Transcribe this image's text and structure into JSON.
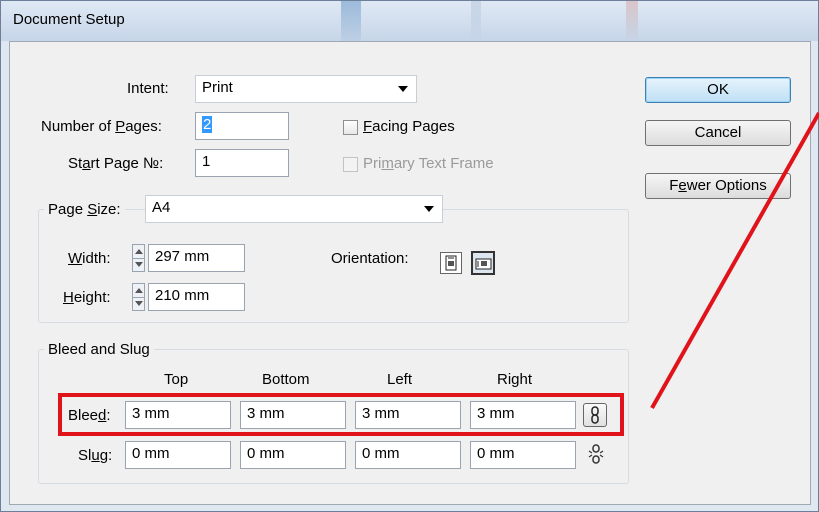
{
  "window": {
    "title": "Document Setup"
  },
  "intent": {
    "label": "Intent:",
    "value": "Print"
  },
  "pages": {
    "label_pre": "Number of ",
    "label_key": "P",
    "label_post": "ages:",
    "value": "2"
  },
  "start_page": {
    "label_pre": "St",
    "label_key": "a",
    "label_post": "rt Page №:",
    "value": "1"
  },
  "facing_pages": {
    "label_key": "F",
    "label_post": "acing Pages",
    "checked": false
  },
  "primary_text_frame": {
    "label_pre": "Pri",
    "label_key": "m",
    "label_post": "ary Text Frame",
    "checked": false,
    "enabled": false
  },
  "buttons": {
    "ok": "OK",
    "cancel": "Cancel",
    "fewer_pre": "F",
    "fewer_key": "e",
    "fewer_post": "wer Options"
  },
  "page_size": {
    "legend_pre": "Page ",
    "legend_key": "S",
    "legend_post": "ize:",
    "value": "A4",
    "width_label_key": "W",
    "width_label_post": "idth:",
    "width_value": "297 mm",
    "height_label_key": "H",
    "height_label_post": "eight:",
    "height_value": "210 mm",
    "orientation_label": "Orientation:"
  },
  "bleed_slug": {
    "legend": "Bleed and Slug",
    "columns": [
      "Top",
      "Bottom",
      "Left",
      "Right"
    ],
    "bleed_label_pre": "Blee",
    "bleed_label_key": "d",
    "bleed_label_post": ":",
    "bleed_values": [
      "3 mm",
      "3 mm",
      "3 mm",
      "3 mm"
    ],
    "slug_label_pre": "Sl",
    "slug_label_key": "u",
    "slug_label_post": "g:",
    "slug_values": [
      "0 mm",
      "0 mm",
      "0 mm",
      "0 mm"
    ]
  },
  "icons": {
    "orientation_portrait": "portrait-icon",
    "orientation_landscape": "landscape-icon",
    "chain": "chain-link-icon",
    "chain_broken": "chain-broken-icon"
  },
  "colors": {
    "highlight": "#e0131a",
    "default_button": "#bfe0f5",
    "selection": "#3399ff"
  }
}
